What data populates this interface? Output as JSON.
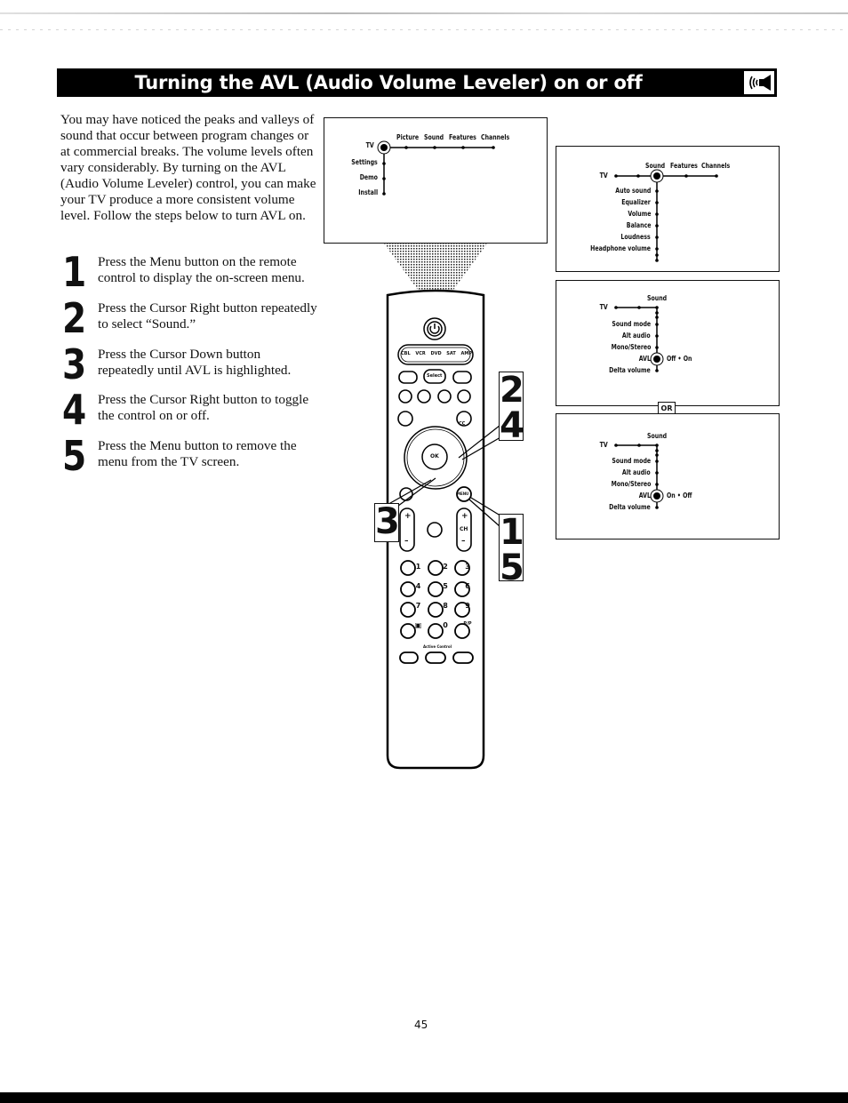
{
  "header": {
    "title": "Turning the AVL (Audio Volume Leveler) on or off",
    "icon": "speaker-sound-icon"
  },
  "intro": "You may have noticed the peaks and valleys of sound that occur between program changes or at commercial breaks. The volume levels often vary considerably. By turning on the AVL (Audio Volume Leveler) control, you can make your TV produce a more consistent volume level. Follow the steps below to turn AVL on.",
  "steps": [
    {
      "number": "1",
      "text": "Press the Menu button on the remote control to display the on-screen menu."
    },
    {
      "number": "2",
      "text": "Press the Cursor Right button repeatedly to select “Sound.”"
    },
    {
      "number": "3",
      "text": "Press the Cursor Down button repeatedly until AVL is highlighted."
    },
    {
      "number": "4",
      "text": "Press the Cursor Right button to toggle the control on or off."
    },
    {
      "number": "5",
      "text": "Press the Menu button to remove the menu from the TV screen."
    }
  ],
  "menu_main": {
    "root": "TV",
    "top_items": [
      "Picture",
      "Sound",
      "Features",
      "Channels"
    ],
    "side_items": [
      "Settings",
      "Demo",
      "Install"
    ]
  },
  "menu_sound": {
    "root": "TV",
    "top_items": [
      "Sound",
      "Features",
      "Channels"
    ],
    "side_items": [
      "Auto sound",
      "Equalizer",
      "Volume",
      "Balance",
      "Loudness",
      "Headphone volume"
    ]
  },
  "menu_avl_a": {
    "root": "TV",
    "heading": "Sound",
    "items": [
      "Sound mode",
      "Alt audio",
      "Mono/Stereo",
      "AVL",
      "Delta volume"
    ],
    "toggle": "Off • On"
  },
  "or_label": "OR",
  "menu_avl_b": {
    "root": "TV",
    "heading": "Sound",
    "items": [
      "Sound mode",
      "Alt audio",
      "Mono/Stereo",
      "AVL",
      "Delta volume"
    ],
    "toggle": "On • Off"
  },
  "remote": {
    "source_labels": [
      "CBL",
      "VCR",
      "DVD",
      "SAT",
      "AMP"
    ],
    "select_label": "Select",
    "ok_label": "OK",
    "menu_label": "MENU",
    "ch_label": "CH",
    "plus": "+",
    "minus": "–",
    "cc_label": "CC",
    "digits": [
      "1",
      "2",
      "3",
      "4",
      "5",
      "6",
      "7",
      "8",
      "9",
      "",
      "0",
      "P/P"
    ],
    "active_control": "Active Control"
  },
  "callouts": {
    "a": [
      "2",
      "4"
    ],
    "b": [
      "3"
    ],
    "c": [
      "1",
      "5"
    ]
  },
  "footer": {
    "page_number": "45"
  }
}
